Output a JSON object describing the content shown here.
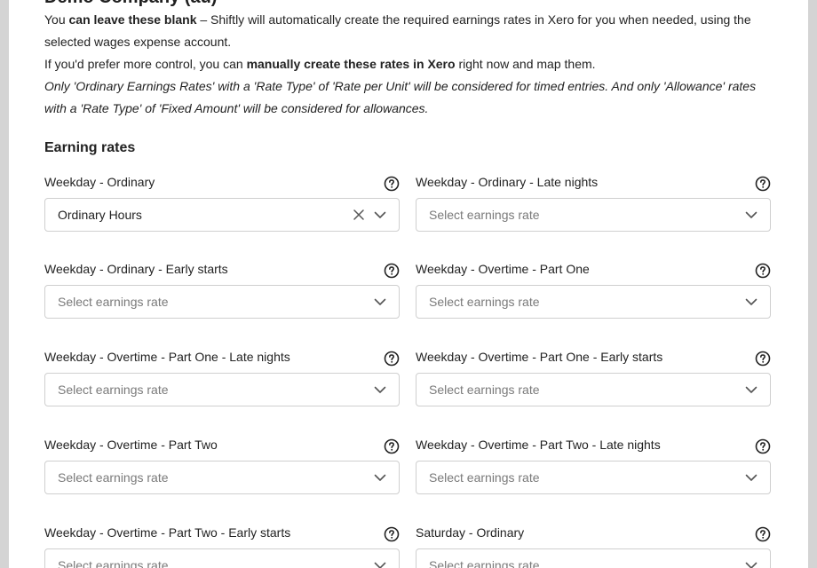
{
  "company": {
    "title": "Demo Company (au)"
  },
  "intro": {
    "line1_prefix": "You ",
    "line1_bold": "can leave these blank",
    "line1_suffix": " – Shiftly will automatically create the required earnings rates in Xero for you when needed, using the selected wages expense account.",
    "line2_prefix": "If you'd prefer more control, you can ",
    "line2_bold": "manually create these rates in Xero",
    "line2_suffix": " right now and map them.",
    "line3": "Only 'Ordinary Earnings Rates' with a 'Rate Type' of 'Rate per Unit' will be considered for timed entries. And only 'Allowance' rates with a 'Rate Type' of 'Fixed Amount' will be considered for allowances."
  },
  "section": {
    "title": "Earning rates"
  },
  "fields": [
    {
      "label": "Weekday - Ordinary",
      "value": "Ordinary Hours",
      "placeholder": ""
    },
    {
      "label": "Weekday - Ordinary - Late nights",
      "value": "",
      "placeholder": "Select earnings rate"
    },
    {
      "label": "Weekday - Ordinary - Early starts",
      "value": "",
      "placeholder": "Select earnings rate"
    },
    {
      "label": "Weekday - Overtime - Part One",
      "value": "",
      "placeholder": "Select earnings rate"
    },
    {
      "label": "Weekday - Overtime - Part One - Late nights",
      "value": "",
      "placeholder": "Select earnings rate"
    },
    {
      "label": "Weekday - Overtime - Part One - Early starts",
      "value": "",
      "placeholder": "Select earnings rate"
    },
    {
      "label": "Weekday - Overtime - Part Two",
      "value": "",
      "placeholder": "Select earnings rate"
    },
    {
      "label": "Weekday - Overtime - Part Two - Late nights",
      "value": "",
      "placeholder": "Select earnings rate"
    },
    {
      "label": "Weekday - Overtime - Part Two - Early starts",
      "value": "",
      "placeholder": "Select earnings rate"
    },
    {
      "label": "Saturday - Ordinary",
      "value": "",
      "placeholder": "Select earnings rate"
    }
  ],
  "icons": {
    "help": "question-circle-icon",
    "clear": "x-icon",
    "dropdown": "chevron-down-icon"
  },
  "colors": {
    "border": "#cfcfcf",
    "placeholder": "#7a7a7a",
    "text": "#222222"
  }
}
